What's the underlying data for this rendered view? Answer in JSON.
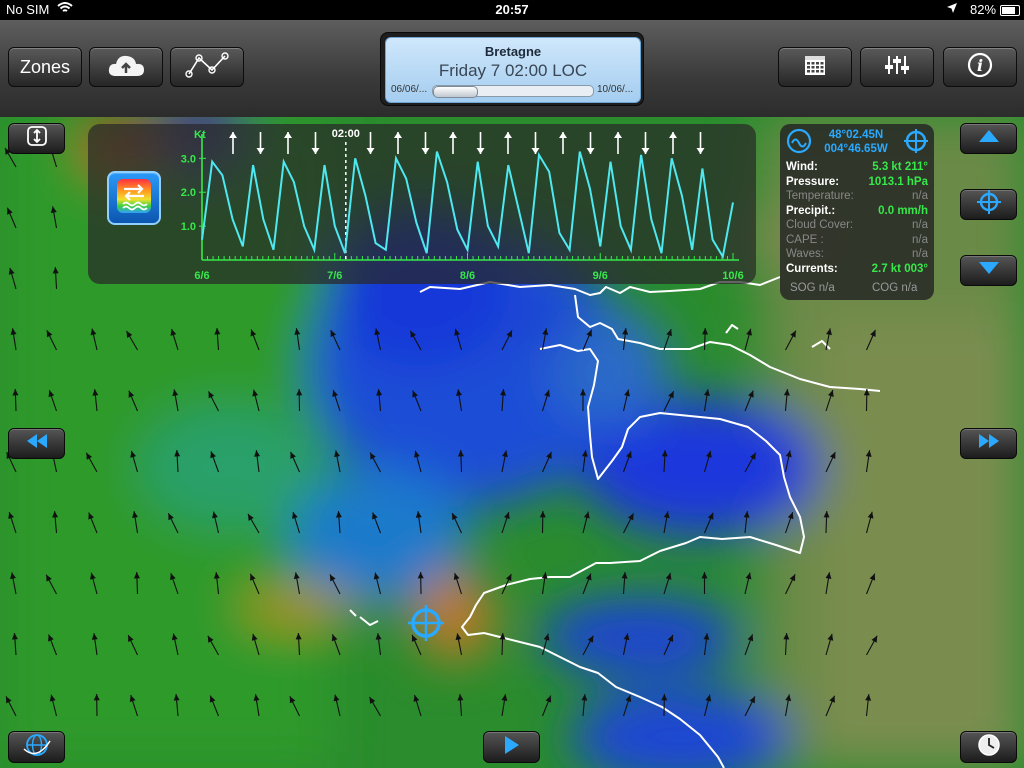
{
  "status": {
    "carrier": "No SIM",
    "time": "20:57",
    "battery": "82%"
  },
  "toolbar": {
    "zones_label": "Zones"
  },
  "zone": {
    "title": "Bretagne",
    "date": "Friday 7 02:00 LOC",
    "start": "06/06/...",
    "end": "10/06/...",
    "progress": 0.27
  },
  "chart_data": {
    "type": "line",
    "title": "",
    "ylabel": "Kt",
    "xlabel": "",
    "ylim": [
      0,
      3.6
    ],
    "yticks": [
      "1.0",
      "2.0",
      "3.0"
    ],
    "categories": [
      "6/6",
      "7/6",
      "8/6",
      "9/6",
      "10/6"
    ],
    "cursor_label": "02:00",
    "series": [
      {
        "values": [
          0.6,
          2.9,
          2.5,
          1.2,
          0.4,
          2.8,
          1.2,
          0.3,
          2.9,
          2.3,
          1.0,
          0.3,
          2.8,
          1.0,
          0.2,
          3.0,
          1.9,
          0.5,
          0.3,
          3.0,
          2.4,
          1.1,
          0.2,
          3.2,
          2.3,
          0.9,
          0.3,
          2.9,
          1.0,
          0.4,
          2.8,
          1.5,
          0.2,
          3.1,
          2.6,
          0.8,
          0.3,
          3.2,
          2.1,
          0.4,
          2.9,
          1.0,
          0.3,
          3.1,
          1.2,
          0.2,
          3.0,
          1.9,
          0.3,
          2.7,
          0.6,
          0.1,
          1.7
        ],
        "color": "#4de8f0"
      }
    ]
  },
  "info": {
    "lat": "48°02.45N",
    "lon": "004°46.65W",
    "rows": [
      {
        "label": "Wind:",
        "value": "5.3 kt 211°"
      },
      {
        "label": "Pressure:",
        "value": "1013.1 hPa"
      },
      {
        "label": "Temperature:",
        "value": "n/a"
      },
      {
        "label": "Precipit.:",
        "value": "0.0 mm/h"
      },
      {
        "label": "Cloud Cover:",
        "value": "n/a"
      },
      {
        "label": "CAPE :",
        "value": "n/a"
      },
      {
        "label": "Waves:",
        "value": "n/a"
      },
      {
        "label": "Currents:",
        "value": "2.7 kt 003°"
      }
    ],
    "sog": "SOG n/a",
    "cog": "COG n/a"
  },
  "icons": {
    "cloud": "cloud-download-icon",
    "route": "route-icon",
    "calendar": "calendar-icon",
    "settings": "sliders-icon",
    "info": "info-icon",
    "resize": "resize-vertical-icon",
    "target": "crosshair-icon",
    "up": "arrow-up-icon",
    "down": "arrow-down-icon",
    "rewind": "rewind-icon",
    "forward": "fast-forward-icon",
    "play": "play-icon",
    "globe": "globe-icon",
    "clock": "clock-icon"
  },
  "colors": {
    "accent": "#2aa9ff",
    "series": "#4de8f0",
    "value_green": "#37e84a"
  }
}
